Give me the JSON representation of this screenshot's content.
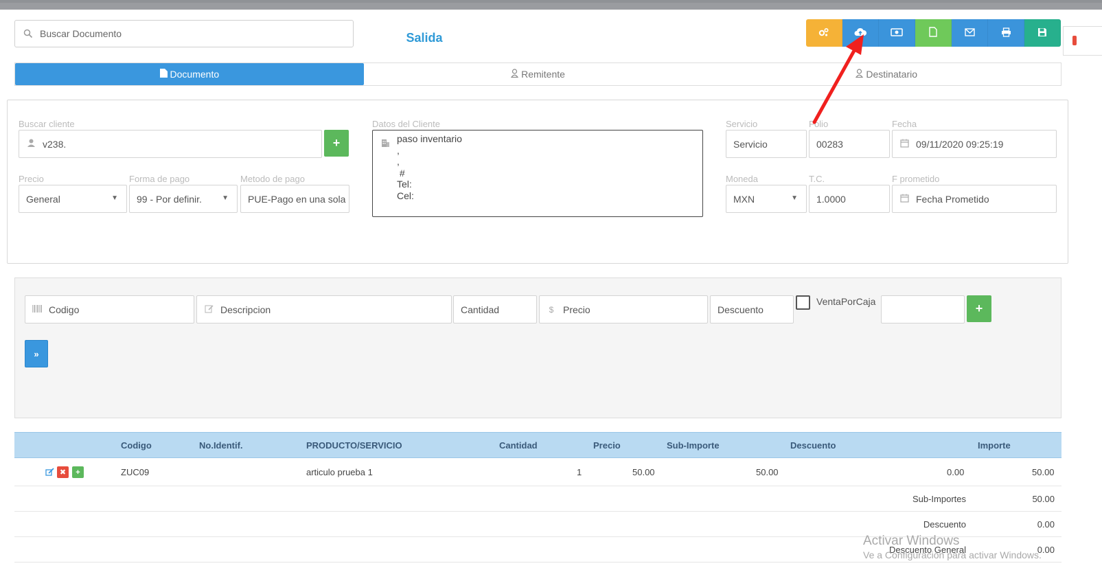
{
  "search": {
    "placeholder": "Buscar Documento"
  },
  "page_title": "Salida",
  "toolbar": {
    "buttons": [
      {
        "icon": "cogs-icon",
        "color": "#f5b237"
      },
      {
        "icon": "cloud-upload-icon",
        "color": "#3b94db"
      },
      {
        "icon": "money-icon",
        "color": "#3b94db"
      },
      {
        "icon": "file-icon",
        "color": "#6fc95a"
      },
      {
        "icon": "envelope-icon",
        "color": "#3b94db"
      },
      {
        "icon": "print-icon",
        "color": "#3b94db"
      },
      {
        "icon": "save-icon",
        "color": "#27b08d"
      }
    ]
  },
  "tabs": [
    {
      "label": "Documento",
      "active": true
    },
    {
      "label": "Remitente",
      "active": false
    },
    {
      "label": "Destinatario",
      "active": false
    }
  ],
  "form": {
    "buscar_cliente": {
      "label": "Buscar cliente",
      "value": "v238."
    },
    "datos_cliente": {
      "label": "Datos del Cliente",
      "lines": [
        "paso inventario",
        ",",
        ",",
        " #",
        "Tel:",
        "Cel:"
      ]
    },
    "servicio": {
      "label": "Servicio",
      "value": "Servicio"
    },
    "folio": {
      "label": "Folio",
      "value": "00283"
    },
    "fecha": {
      "label": "Fecha",
      "value": "09/11/2020 09:25:19"
    },
    "precio": {
      "label": "Precio",
      "value": "General"
    },
    "forma_pago": {
      "label": "Forma de pago",
      "value": "99 - Por definir."
    },
    "metodo_pago": {
      "label": "Metodo de pago",
      "value": "PUE-Pago en una sola"
    },
    "moneda": {
      "label": "Moneda",
      "value": "MXN"
    },
    "tc": {
      "label": "T.C.",
      "value": "1.0000"
    },
    "f_prometido": {
      "label": "F prometido",
      "placeholder": "Fecha Prometido"
    }
  },
  "entry": {
    "codigo": "Codigo",
    "descripcion": "Descripcion",
    "cantidad": "Cantidad",
    "precio": "Precio",
    "descuento": "Descuento",
    "venta_por_caja": "VentaPorCaja",
    "add_label": "+",
    "next_label": "»"
  },
  "table": {
    "headers": [
      "Codigo",
      "No.Identif.",
      "PRODUCTO/SERVICIO",
      "Cantidad",
      "Precio",
      "Sub-Importe",
      "Descuento",
      "Importe"
    ],
    "rows": [
      {
        "codigo": "ZUC09",
        "identif": "",
        "producto": "articulo prueba 1",
        "cantidad": "1",
        "precio": "50.00",
        "subimporte": "50.00",
        "descuento": "0.00",
        "importe": "50.00"
      }
    ],
    "summary": [
      {
        "label": "Sub-Importes",
        "value": "50.00"
      },
      {
        "label": "Descuento",
        "value": "0.00"
      },
      {
        "label": "Descuento General",
        "value": "0.00"
      }
    ]
  },
  "watermark": {
    "line1": "Activar Windows",
    "line2": "Ve a Configuración para activar Windows."
  }
}
